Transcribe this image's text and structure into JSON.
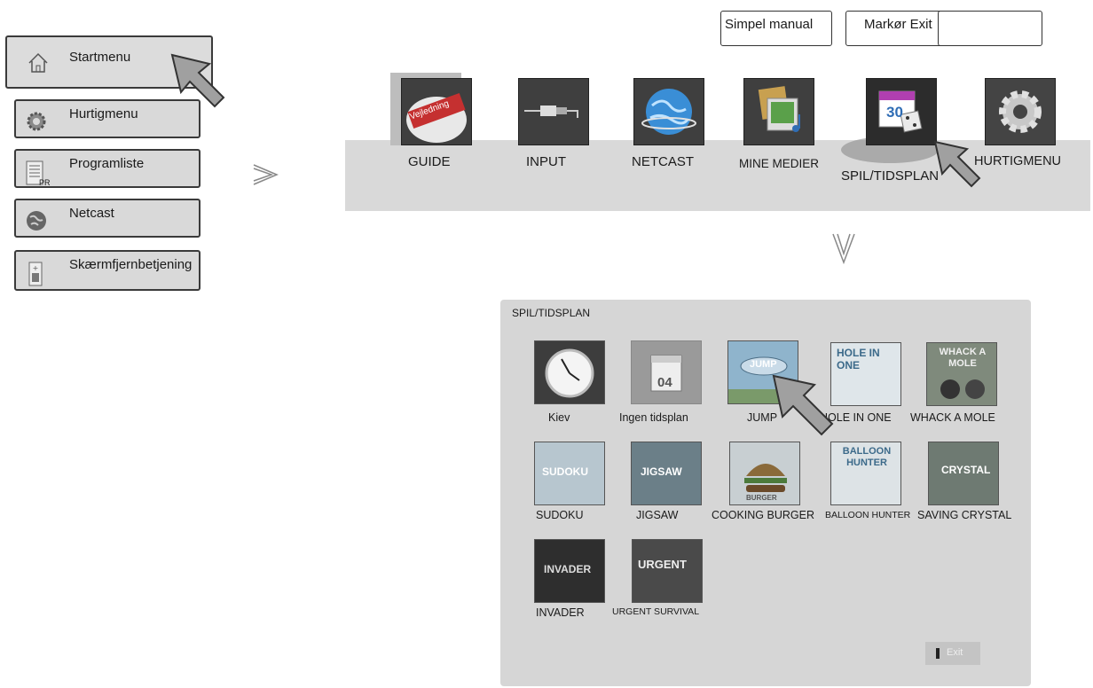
{
  "left_menu": {
    "items": [
      {
        "label": "Startmenu",
        "icon": "home-icon"
      },
      {
        "label": "Hurtigmenu",
        "icon": "gear-icon"
      },
      {
        "label": "Programliste",
        "icon": "list-icon",
        "badge": "PR"
      },
      {
        "label": "Netcast",
        "icon": "globe-icon"
      },
      {
        "label": "Skærmfjernbetjening",
        "icon": "remote-icon"
      }
    ]
  },
  "top_buttons": {
    "simple_manual": "Simpel manual",
    "cursor_exit": "Markør Exit",
    "blank": ""
  },
  "home_bar": {
    "items": [
      {
        "label": "GUIDE",
        "icon": "guide-icon",
        "badge": "Vejledning"
      },
      {
        "label": "INPUT",
        "icon": "input-plug-icon"
      },
      {
        "label": "NETCAST",
        "icon": "globe-icon"
      },
      {
        "label": "MINE MEDIER",
        "icon": "media-icon"
      },
      {
        "label": "SPIL/TIDSPLAN",
        "icon": "calendar-icon",
        "calendar_day": "30"
      },
      {
        "label": "HURTIGMENU",
        "icon": "gear-icon"
      }
    ]
  },
  "panel": {
    "title": "SPIL/TIDSPLAN",
    "ingen_tidsplan_day": "04",
    "games": [
      {
        "label": "Kiev",
        "tile_text": ""
      },
      {
        "label": "Ingen tidsplan",
        "tile_text": ""
      },
      {
        "label": "JUMP",
        "tile_text": "JUMP"
      },
      {
        "label": "HOLE IN ONE",
        "tile_text": "HOLE IN ONE"
      },
      {
        "label": "WHACK A MOLE",
        "tile_text": "WHACK A MOLE"
      },
      {
        "label": "SUDOKU",
        "tile_text": "SUDOKU"
      },
      {
        "label": "JIGSAW",
        "tile_text": "JIGSAW"
      },
      {
        "label": "COOKING BURGER",
        "tile_text": "BURGER"
      },
      {
        "label": "BALLOON HUNTER",
        "tile_text": "BALLOON HUNTER"
      },
      {
        "label": "SAVING CRYSTAL",
        "tile_text": "CRYSTAL"
      },
      {
        "label": "INVADER",
        "tile_text": "INVADER"
      },
      {
        "label": "URGENT SURVIVAL",
        "tile_text": "URGENT"
      }
    ],
    "exit_label": "Exit"
  },
  "colors": {
    "bar": "#d9d9d9",
    "tile": "#3f3f3f",
    "panel": "#d6d6d6",
    "accent_blue": "#2f6db5"
  }
}
